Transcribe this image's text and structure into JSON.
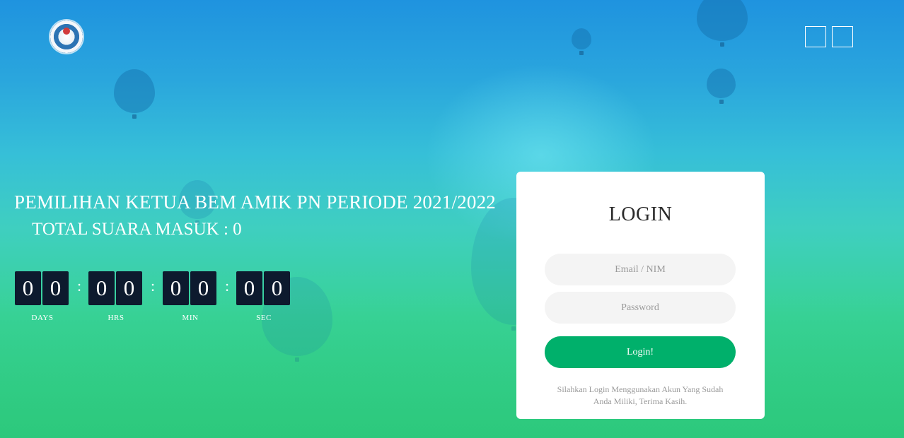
{
  "header": {
    "logo_icon": "campus-emblem-icon",
    "nav_buttons": [
      "menu-square-icon",
      "menu-square-icon"
    ]
  },
  "hero": {
    "title": "PEMILIHAN KETUA BEM AMIK PN PERIODE 2021/2022",
    "subtitle": "TOTAL SUARA MASUK : 0"
  },
  "countdown": {
    "separator": ":",
    "units": [
      {
        "digits": [
          "0",
          "0"
        ],
        "label": "DAYS"
      },
      {
        "digits": [
          "0",
          "0"
        ],
        "label": "HRS"
      },
      {
        "digits": [
          "0",
          "0"
        ],
        "label": "MIN"
      },
      {
        "digits": [
          "0",
          "0"
        ],
        "label": "SEC"
      }
    ]
  },
  "login": {
    "title": "LOGIN",
    "email_placeholder": "Email / NIM",
    "email_value": "",
    "password_placeholder": "Password",
    "password_value": "",
    "button_label": "Login!",
    "note_line1": "Silahkan Login Menggunakan Akun Yang Sudah",
    "note_line2": "Anda Miliki, Terima Kasih."
  },
  "colors": {
    "accent": "#00b06b",
    "digit_bg": "#0d1a2e",
    "sky_top": "#1f93df",
    "field_bottom": "#2fce79"
  }
}
